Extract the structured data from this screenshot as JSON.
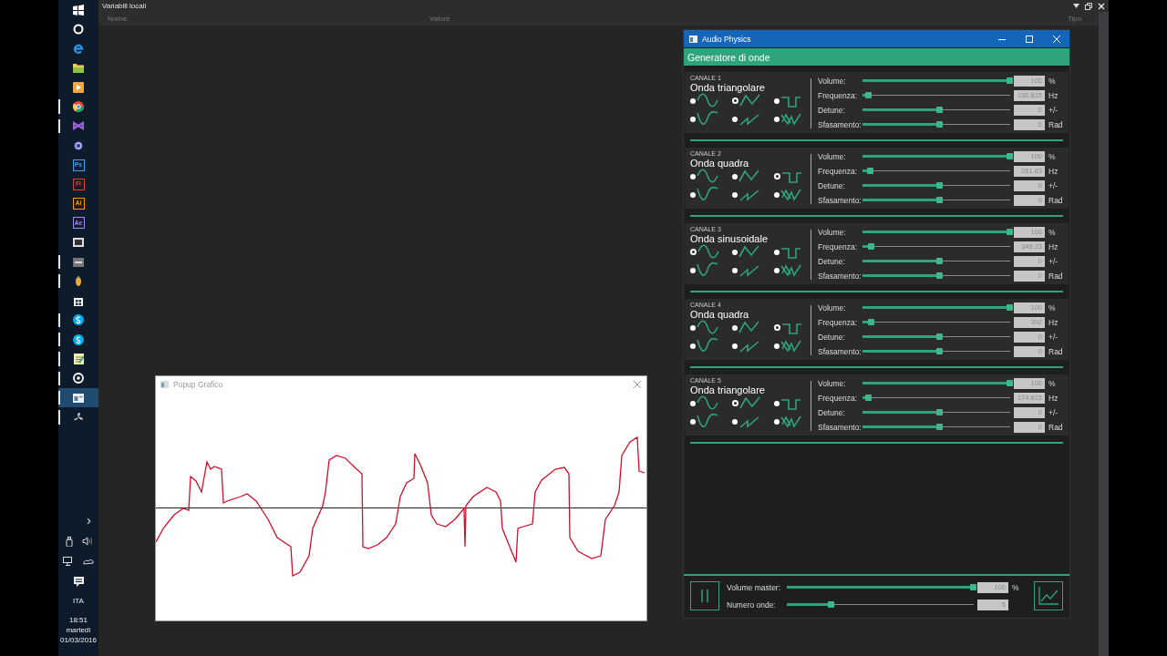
{
  "taskbar": {
    "apps": [
      {
        "kind": "start",
        "running": false,
        "selected": false
      },
      {
        "kind": "ring",
        "running": false,
        "selected": false
      },
      {
        "kind": "arc",
        "running": false,
        "selected": false
      },
      {
        "kind": "folder",
        "running": false,
        "selected": false
      },
      {
        "kind": "play",
        "running": false,
        "selected": false
      },
      {
        "kind": "ball",
        "running": true,
        "selected": false
      },
      {
        "kind": "knot",
        "running": true,
        "selected": false
      },
      {
        "kind": "orbit",
        "running": false,
        "selected": false
      },
      {
        "kind": "tile",
        "label": "Ps",
        "color": "#31a8ff",
        "running": false,
        "selected": false
      },
      {
        "kind": "tile",
        "label": "Fl",
        "color": "#e0402a",
        "running": false,
        "selected": false
      },
      {
        "kind": "tile",
        "label": "Ai",
        "color": "#ff9a00",
        "running": false,
        "selected": false
      },
      {
        "kind": "tile",
        "label": "Ae",
        "color": "#9a8cff",
        "running": false,
        "selected": false
      },
      {
        "kind": "film",
        "running": false,
        "selected": false
      },
      {
        "kind": "block",
        "running": true,
        "selected": false
      },
      {
        "kind": "fruit",
        "running": true,
        "selected": false
      },
      {
        "kind": "bag",
        "running": false,
        "selected": false
      },
      {
        "kind": "chat",
        "running": true,
        "selected": false
      },
      {
        "kind": "chat",
        "running": true,
        "selected": false
      },
      {
        "kind": "note",
        "running": true,
        "selected": false
      },
      {
        "kind": "target",
        "running": true,
        "selected": false
      },
      {
        "kind": "window",
        "running": true,
        "selected": true
      },
      {
        "kind": "fan",
        "running": true,
        "selected": false
      }
    ],
    "tray": {
      "chevron": "›",
      "language": "ITA",
      "time": "18:51",
      "day": "martedì",
      "date": "01/03/2016"
    }
  },
  "locals_panel": {
    "title": "Variabili locali",
    "columns": [
      "Nome",
      "Valore",
      "Tipo"
    ]
  },
  "app_window": {
    "title": "Audio Physics",
    "header": "Generatore di onde",
    "channels": [
      {
        "label": "CANALE 1",
        "wave_name": "Onda triangolare",
        "waveforms": [
          {
            "kind": "sine",
            "selected": false
          },
          {
            "kind": "triangle",
            "selected": true
          },
          {
            "kind": "square",
            "selected": false
          },
          {
            "kind": "inverse",
            "selected": false
          },
          {
            "kind": "saw",
            "selected": false
          },
          {
            "kind": "noise",
            "selected": false
          }
        ],
        "params": [
          {
            "label": "Volume:",
            "level": 1,
            "value": "100",
            "unit": "%"
          },
          {
            "label": "Frequenza:",
            "level": 0.02,
            "value": "130.815",
            "unit": "Hz"
          },
          {
            "label": "Detune:",
            "level": 0.5,
            "value": "0",
            "unit": "+/-"
          },
          {
            "label": "Sfasamento:",
            "level": 0.5,
            "value": "0",
            "unit": "Rad"
          }
        ]
      },
      {
        "label": "CANALE 2",
        "wave_name": "Onda quadra",
        "waveforms": [
          {
            "kind": "sine",
            "selected": false
          },
          {
            "kind": "triangle",
            "selected": false
          },
          {
            "kind": "square",
            "selected": true
          },
          {
            "kind": "inverse",
            "selected": false
          },
          {
            "kind": "saw",
            "selected": false
          },
          {
            "kind": "noise",
            "selected": false
          }
        ],
        "params": [
          {
            "label": "Volume:",
            "level": 1,
            "value": "100",
            "unit": "%"
          },
          {
            "label": "Frequenza:",
            "level": 0.03,
            "value": "261.63",
            "unit": "Hz"
          },
          {
            "label": "Detune:",
            "level": 0.5,
            "value": "0",
            "unit": "+/-"
          },
          {
            "label": "Sfasamento:",
            "level": 0.5,
            "value": "0",
            "unit": "Rad"
          }
        ]
      },
      {
        "label": "CANALE 3",
        "wave_name": "Onda sinusoidale",
        "waveforms": [
          {
            "kind": "sine",
            "selected": true
          },
          {
            "kind": "triangle",
            "selected": false
          },
          {
            "kind": "square",
            "selected": false
          },
          {
            "kind": "inverse",
            "selected": false
          },
          {
            "kind": "saw",
            "selected": false
          },
          {
            "kind": "noise",
            "selected": false
          }
        ],
        "params": [
          {
            "label": "Volume:",
            "level": 1,
            "value": "100",
            "unit": "%"
          },
          {
            "label": "Frequenza:",
            "level": 0.04,
            "value": "349.23",
            "unit": "Hz"
          },
          {
            "label": "Detune:",
            "level": 0.5,
            "value": "0",
            "unit": "+/-"
          },
          {
            "label": "Sfasamento:",
            "level": 0.5,
            "value": "0",
            "unit": "Rad"
          }
        ]
      },
      {
        "label": "CANALE 4",
        "wave_name": "Onda quadra",
        "waveforms": [
          {
            "kind": "sine",
            "selected": false
          },
          {
            "kind": "triangle",
            "selected": false
          },
          {
            "kind": "square",
            "selected": true
          },
          {
            "kind": "inverse",
            "selected": false
          },
          {
            "kind": "saw",
            "selected": false
          },
          {
            "kind": "noise",
            "selected": false
          }
        ],
        "params": [
          {
            "label": "Volume:",
            "level": 1,
            "value": "100",
            "unit": "%"
          },
          {
            "label": "Frequenza:",
            "level": 0.04,
            "value": "392",
            "unit": "Hz"
          },
          {
            "label": "Detune:",
            "level": 0.5,
            "value": "0",
            "unit": "+/-"
          },
          {
            "label": "Sfasamento:",
            "level": 0.5,
            "value": "0",
            "unit": "Rad"
          }
        ]
      },
      {
        "label": "CANALE 5",
        "wave_name": "Onda triangolare",
        "waveforms": [
          {
            "kind": "sine",
            "selected": false
          },
          {
            "kind": "triangle",
            "selected": true
          },
          {
            "kind": "square",
            "selected": false
          },
          {
            "kind": "inverse",
            "selected": false
          },
          {
            "kind": "saw",
            "selected": false
          },
          {
            "kind": "noise",
            "selected": false
          }
        ],
        "params": [
          {
            "label": "Volume:",
            "level": 1,
            "value": "100",
            "unit": "%"
          },
          {
            "label": "Frequenza:",
            "level": 0.02,
            "value": "174.615",
            "unit": "Hz"
          },
          {
            "label": "Detune:",
            "level": 0.5,
            "value": "0",
            "unit": "+/-"
          },
          {
            "label": "Sfasamento:",
            "level": 0.5,
            "value": "0",
            "unit": "Rad"
          }
        ]
      }
    ],
    "master": [
      {
        "label": "Volume master:",
        "level": 1,
        "value": "100",
        "unit": "%"
      },
      {
        "label": "Numero onde:",
        "level": 0.22,
        "value": "5"
      }
    ]
  },
  "popup": {
    "title": "Popup Grafico"
  }
}
